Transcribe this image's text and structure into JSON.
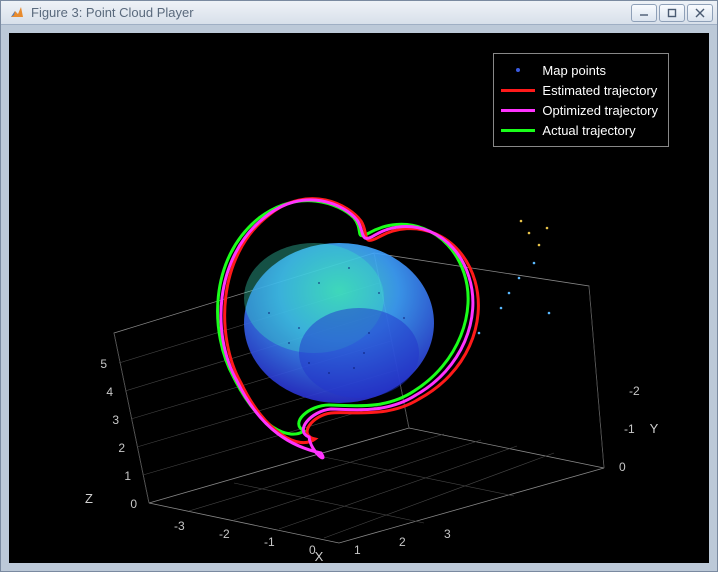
{
  "window": {
    "title": "Figure 3: Point Cloud Player"
  },
  "legend": {
    "items": [
      {
        "label": "Map points",
        "type": "dot",
        "color": "#3b5be0"
      },
      {
        "label": "Estimated trajectory",
        "type": "line",
        "color": "#ff1a1a"
      },
      {
        "label": "Optimized trajectory",
        "type": "line",
        "color": "#ff33ff"
      },
      {
        "label": "Actual trajectory",
        "type": "line",
        "color": "#1aff1a"
      }
    ]
  },
  "axes": {
    "x": {
      "label": "X",
      "ticks": [
        "-3",
        "-2",
        "-1",
        "0",
        "1",
        "2",
        "3"
      ]
    },
    "y": {
      "label": "Y",
      "ticks": [
        "-2",
        "-1",
        "0"
      ]
    },
    "z": {
      "label": "Z",
      "ticks": [
        "0",
        "1",
        "2",
        "3",
        "4",
        "5"
      ]
    }
  },
  "chart_data": {
    "type": "scatter",
    "title": "",
    "notes": "3-D point-cloud SLAM result with three closed-loop trajectories overlaid on reconstructed map points.",
    "axes_ranges": {
      "x": [
        -3.5,
        3.5
      ],
      "y": [
        -2.5,
        0.5
      ],
      "z": [
        0,
        5.5
      ]
    },
    "series": [
      {
        "name": "Map points",
        "type": "points",
        "approx_count": 6000,
        "color": "parula_colormap",
        "spatial_extent": {
          "x": [
            -2,
            2
          ],
          "y": [
            -2,
            0
          ],
          "z": [
            1,
            5
          ]
        }
      },
      {
        "name": "Estimated trajectory",
        "type": "line3d",
        "color": "#ff1a1a",
        "closed_loop": true,
        "approx_extent": {
          "x": [
            -2.0,
            2.7
          ],
          "y": [
            -2.0,
            0.4
          ],
          "z": [
            2,
            4
          ]
        }
      },
      {
        "name": "Optimized trajectory",
        "type": "line3d",
        "color": "#ff33ff",
        "closed_loop": true,
        "approx_extent": {
          "x": [
            -2.0,
            2.6
          ],
          "y": [
            -2.0,
            0.4
          ],
          "z": [
            2,
            4
          ]
        }
      },
      {
        "name": "Actual trajectory",
        "type": "line3d",
        "color": "#1aff1a",
        "closed_loop": true,
        "approx_extent": {
          "x": [
            -2.0,
            2.6
          ],
          "y": [
            -2.0,
            0.4
          ],
          "z": [
            2,
            4
          ]
        }
      }
    ]
  }
}
